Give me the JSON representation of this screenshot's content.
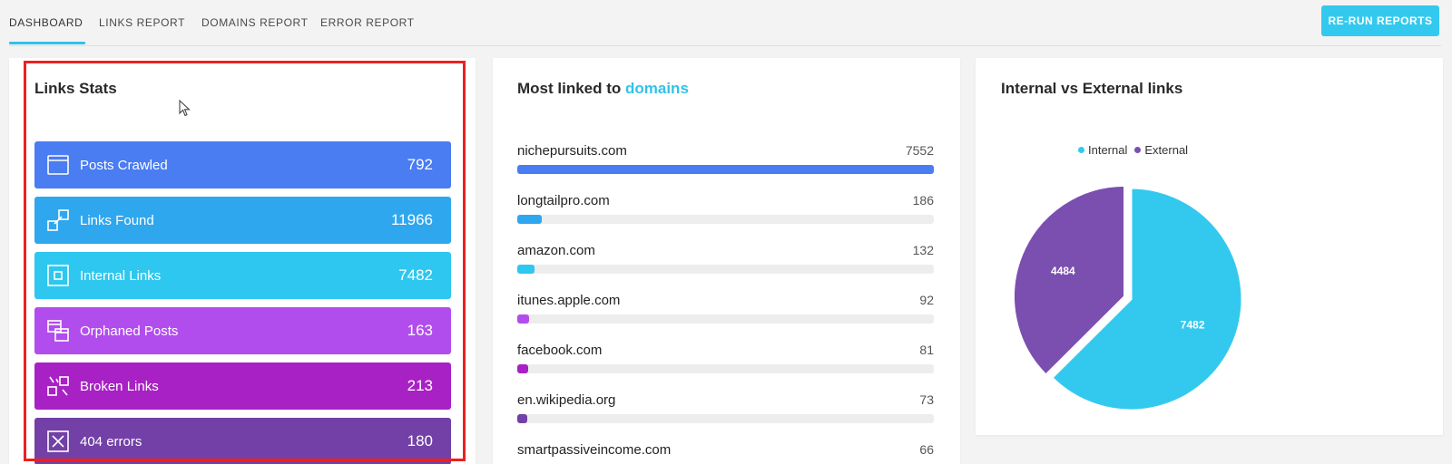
{
  "nav": {
    "tabs": [
      {
        "label": "DASHBOARD",
        "active": true
      },
      {
        "label": "LINKS REPORT",
        "active": false
      },
      {
        "label": "DOMAINS REPORT",
        "active": false
      },
      {
        "label": "ERROR REPORT",
        "active": false
      }
    ],
    "rerun_label": "RE-RUN REPORTS",
    "accent_color": "#33c2e8"
  },
  "links_stats": {
    "title": "Links Stats",
    "items": [
      {
        "label": "Posts Crawled",
        "value": "792",
        "icon": "browser-window-icon",
        "color": "#4a7cf2"
      },
      {
        "label": "Links Found",
        "value": "11966",
        "icon": "link-squares-icon",
        "color": "#2fa7ee"
      },
      {
        "label": "Internal Links",
        "value": "7482",
        "icon": "internal-square-icon",
        "color": "#2ec7ef"
      },
      {
        "label": "Orphaned Posts",
        "value": "163",
        "icon": "stacked-windows-icon",
        "color": "#b24ded"
      },
      {
        "label": "Broken Links",
        "value": "213",
        "icon": "broken-link-icon",
        "color": "#a821c4"
      },
      {
        "label": "404 errors",
        "value": "180",
        "icon": "close-box-icon",
        "color": "#7240a6"
      }
    ]
  },
  "domains": {
    "title_prefix": "Most linked to ",
    "title_highlight": "domains",
    "max": 7552,
    "items": [
      {
        "name": "nichepursuits.com",
        "count": "7552",
        "value": 7552,
        "color": "#4a7cf2"
      },
      {
        "name": "longtailpro.com",
        "count": "186",
        "value": 186,
        "color": "#2fa7ee"
      },
      {
        "name": "amazon.com",
        "count": "132",
        "value": 132,
        "color": "#2ec7ef"
      },
      {
        "name": "itunes.apple.com",
        "count": "92",
        "value": 92,
        "color": "#b24ded"
      },
      {
        "name": "facebook.com",
        "count": "81",
        "value": 81,
        "color": "#a821c4"
      },
      {
        "name": "en.wikipedia.org",
        "count": "73",
        "value": 73,
        "color": "#7240a6"
      },
      {
        "name": "smartpassiveincome.com",
        "count": "66",
        "value": 66,
        "color": "#4a7cf2"
      }
    ]
  },
  "chart_data": {
    "type": "pie",
    "title": "Internal vs External links",
    "categories": [
      "Internal",
      "External"
    ],
    "values": [
      7482,
      4484
    ],
    "colors": [
      "#33c9ef",
      "#7b4fb0"
    ],
    "legend": "top"
  }
}
